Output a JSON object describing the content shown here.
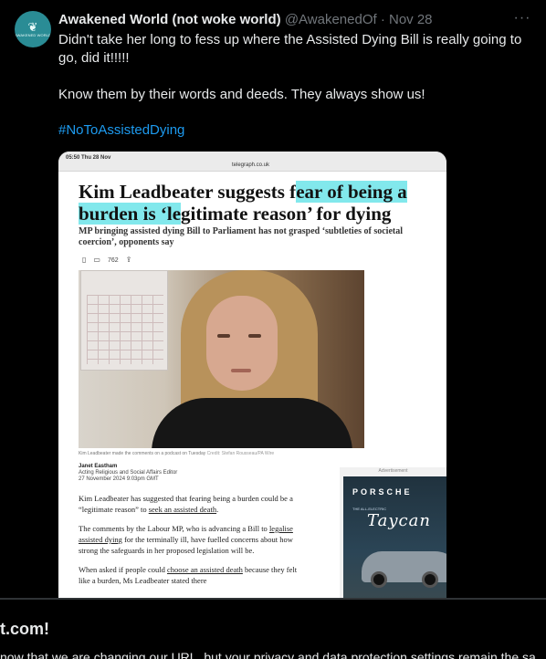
{
  "tweet": {
    "display_name": "Awakened World (not woke world)",
    "handle": "@AwakenedOf",
    "separator": "·",
    "date": "Nov 28",
    "avatar_text": "AWAKENED WORLD",
    "more_icon": "more-horizontal-icon",
    "text_lines": [
      "Didn't take her long to fess up where the Assisted Dying Bill is really going to go, did it!!!!!",
      "Know them by their words and deeds. They always show us!"
    ],
    "hashtag": "#NoToAssistedDying"
  },
  "screenshot": {
    "status_time": "05:50  Thu 28 Nov",
    "url": "telegraph.co.uk",
    "headline_part1": "Kim Leadbeater suggests f",
    "headline_highlight1": "ear of being a",
    "headline_highlight2": "burden is ‘le",
    "headline_part2": "gitimate reason’ for dying",
    "standfirst": "MP bringing assisted dying Bill to Parliament has not grasped ‘subtleties of societal coercion’, opponents say",
    "comment_count": "762",
    "caption": "Kim Leadbeater made the comments on a podcast on Tuesday",
    "credit": "Credit: Stefan Rousseau/PA Wire",
    "author": "Janet Eastham",
    "author_role": "Acting Religious and Social Affairs Editor",
    "published": "27 November 2024 9:03pm GMT",
    "para1_a": "Kim Leadbeater has suggested that fearing being a burden could be a “legitimate reason” to ",
    "para1_link": "seek an assisted death",
    "para1_b": ".",
    "para2_a": "The comments by the Labour MP, who is advancing a Bill to ",
    "para2_link": "legalise assisted dying",
    "para2_b": " for the terminally ill, have fuelled concerns about how strong the safeguards in her proposed legislation will be.",
    "para3_a": "When asked if people could ",
    "para3_link": "choose an assisted death",
    "para3_b": " because they felt like a burden, Ms Leadbeater stated there",
    "ad_label": "Advertisement",
    "ad_brand": "PORSCHE",
    "ad_sub": "THE ALL-ELECTRIC",
    "ad_model": "Taycan"
  },
  "banner": {
    "title": "t.com!",
    "text": "now that we are changing our URL, but your privacy and data protection settings remain the sa"
  },
  "colors": {
    "background": "#000000",
    "text": "#e7e9ea",
    "secondary": "#71767b",
    "link": "#1d9bf0",
    "highlight": "#82e8ec"
  }
}
